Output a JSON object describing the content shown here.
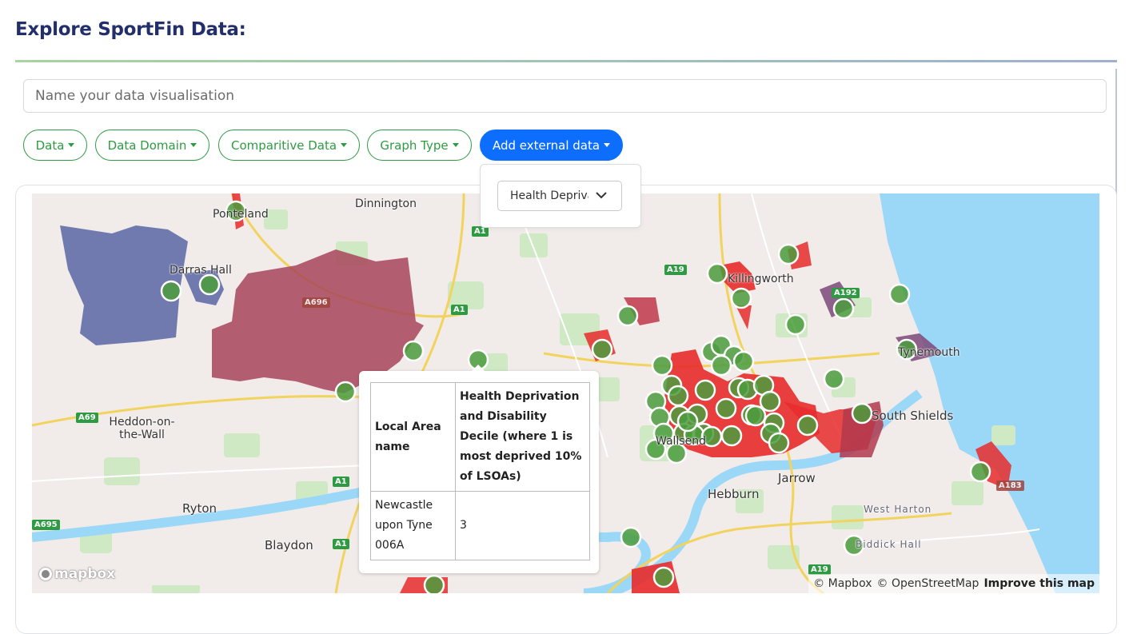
{
  "page": {
    "title": "Explore SportFin Data:"
  },
  "name_input": {
    "placeholder": "Name your data visualisation",
    "value": ""
  },
  "toolbar": {
    "data_label": "Data",
    "domain_label": "Data Domain",
    "comparative_label": "Comparitive Data",
    "graph_label": "Graph Type",
    "external_label": "Add external data"
  },
  "external_dropdown": {
    "selected": "Health Deprivation and Disability Decile"
  },
  "map": {
    "places": [
      "Dinnington",
      "Ponteland",
      "Darras Hall",
      "Heddon-on-the-Wall",
      "Ryton",
      "Blaydon",
      "Hebburn",
      "Jarrow",
      "South Shields",
      "Tynemouth",
      "Killingworth",
      "West Harton",
      "Biddick Hall",
      "Wallsend"
    ],
    "roads": [
      "A1",
      "A19",
      "A696",
      "A69",
      "A192",
      "A183",
      "A695"
    ],
    "logo": "mapbox",
    "attribution": [
      "© Mapbox",
      "© OpenStreetMap"
    ],
    "improve_link": "Improve this map",
    "colors": {
      "water": "#9bd8f8",
      "land": "#f1ece9",
      "parks": "#cfe9c5",
      "roads": "#f2d35e",
      "deprived": "#e82b2b",
      "marker": "#4b9c3d"
    }
  },
  "popup": {
    "col1_header": "Local Area name",
    "col2_header": "Health Deprivation and Disability Decile (where 1 is most deprived 10% of LSOAs)",
    "area_name": "Newcastle upon Tyne 006A",
    "decile": "3"
  }
}
